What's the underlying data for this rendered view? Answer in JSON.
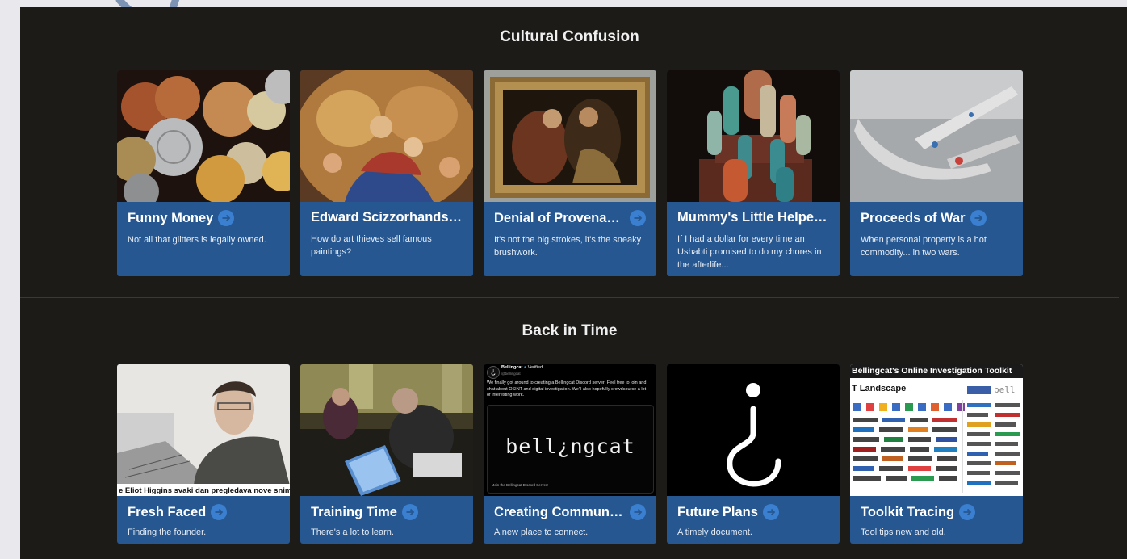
{
  "sections": [
    {
      "title": "Cultural Confusion",
      "cards": [
        {
          "title": "Funny Money",
          "desc": "Not all that glitters is legally owned.",
          "thumb": "coins-image"
        },
        {
          "title": "Edward Scizzorhands: ...",
          "desc": "How do art thieves sell famous paintings?",
          "thumb": "madonna-painting-image"
        },
        {
          "title": "Denial of Provenance",
          "desc": "It's not the big strokes, it's the sneaky brushwork.",
          "thumb": "framed-painting-image"
        },
        {
          "title": "Mummy's Little Helper ...",
          "desc": "If I had a dollar for every time an Ushabti promised to do my chores in the afterlife...",
          "thumb": "ushabti-figures-image"
        },
        {
          "title": "Proceeds of War",
          "desc": "When personal property is a hot commodity... in two wars.",
          "thumb": "daggers-image"
        }
      ]
    },
    {
      "title": "Back in Time",
      "cards": [
        {
          "title": "Fresh Faced",
          "desc": "Finding the founder.",
          "thumb": "founder-photo-image",
          "caption": "e Eliot Higgins svaki dan pregledava nove snim"
        },
        {
          "title": "Training Time",
          "desc": "There's a lot to learn.",
          "thumb": "training-photo-image"
        },
        {
          "title": "Creating Community",
          "desc": "A new place to connect.",
          "thumb": "tweet-screenshot-image",
          "tweet": {
            "name": "Bellingcat",
            "verified": "Verified",
            "handle": "@bellingcat",
            "text": "We finally got around to creating a Bellingcat Discord server! Feel free to join and chat about OSINT and digital investigation. We'll also hopefully crowdsource a lot of interesting work.",
            "logo": "bell¿ngcat",
            "footer": "Join the Bellingcat Discord Server!"
          }
        },
        {
          "title": "Future Plans",
          "desc": "A timely document.",
          "thumb": "bellingcat-logo-image"
        },
        {
          "title": "Toolkit Tracing",
          "desc": "Tool tips new and old.",
          "thumb": "toolkit-screenshot-image",
          "toolkit": {
            "header": "Bellingcat's Online Investigation Toolkit",
            "landscape": "T Landscape",
            "brand": "bell"
          }
        }
      ]
    }
  ],
  "colors": {
    "panel": "#1c1b18",
    "card": "#265790",
    "arrow": "#3a7fd0"
  }
}
